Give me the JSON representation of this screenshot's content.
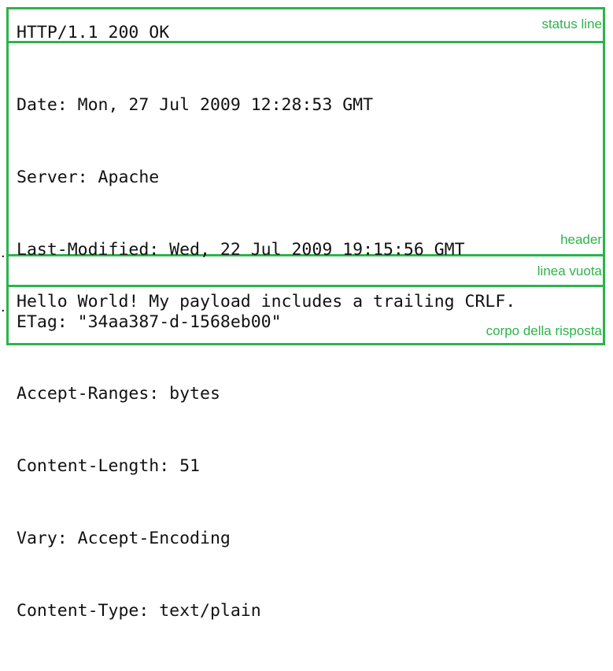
{
  "status_section": {
    "text": "HTTP/1.1 200 OK",
    "label": "status line"
  },
  "header_section": {
    "lines": [
      "Date: Mon, 27 Jul 2009 12:28:53 GMT",
      "Server: Apache",
      "Last-Modified: Wed, 22 Jul 2009 19:15:56 GMT",
      "ETag: \"34aa387-d-1568eb00\"",
      "Accept-Ranges: bytes",
      "Content-Length: 51",
      "Vary: Accept-Encoding",
      "Content-Type: text/plain"
    ],
    "label": "header"
  },
  "empty_line_section": {
    "label": "linea vuota"
  },
  "body_section": {
    "text": "Hello World! My payload includes a trailing CRLF.",
    "label": "corpo della risposta"
  },
  "markers": {
    "dot": "."
  },
  "colors": {
    "accent": "#2db34a",
    "text": "#111111",
    "background": "#ffffff"
  }
}
